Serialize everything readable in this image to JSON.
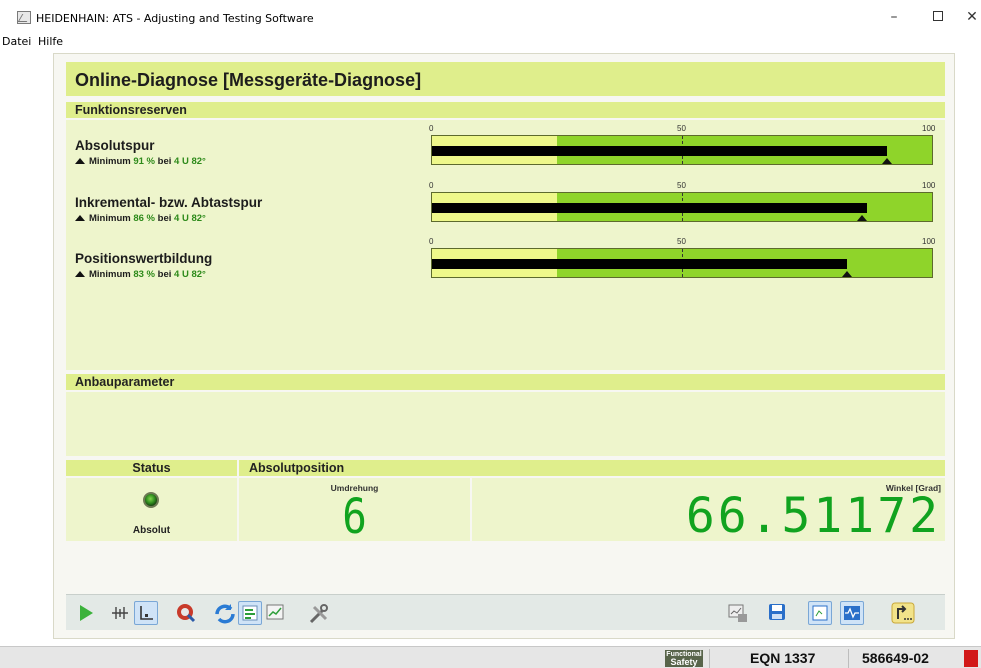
{
  "window": {
    "title": "HEIDENHAIN: ATS - Adjusting and Testing Software",
    "min_symbol": "–",
    "close_symbol": "✕"
  },
  "menu": [
    "Datei",
    "Hilfe"
  ],
  "header": {
    "title": "Online-Diagnose [Messgeräte-Diagnose]"
  },
  "sections": {
    "funktionsreserven": "Funktionsreserven",
    "anbauparameter": "Anbauparameter"
  },
  "scale_labels": [
    "0",
    "50",
    "100"
  ],
  "reserves": [
    {
      "name": "Absolutspur",
      "min_prefix": "Minimum",
      "min_value": "91 %",
      "bei": "bei",
      "at_value": "4 U 82°",
      "value": 91,
      "minimum": 91
    },
    {
      "name": "Inkremental- bzw. Abtastspur",
      "min_prefix": "Minimum",
      "min_value": "86 %",
      "bei": "bei",
      "at_value": "4 U 82°",
      "value": 87,
      "minimum": 86
    },
    {
      "name": "Positionswertbildung",
      "min_prefix": "Minimum",
      "min_value": "83 %",
      "bei": "bei",
      "at_value": "4 U 82°",
      "value": 83,
      "minimum": 83
    }
  ],
  "status": {
    "header": "Status",
    "text": "Absolut",
    "led_color": "#2f8a1e"
  },
  "position": {
    "header": "Absolutposition",
    "rev_label": "Umdrehung",
    "rev_value": "6",
    "angle_label": "Winkel [Grad]",
    "angle_value": "66.51172"
  },
  "toolbar": {
    "icons": [
      "play-icon",
      "grid-icon",
      "axis-icon",
      "magnet-icon",
      "refresh-icon",
      "bars-icon",
      "chart-icon",
      "tools-icon",
      "export-icon",
      "save-icon",
      "view-icon",
      "scope-icon",
      "exit-icon"
    ]
  },
  "footer": {
    "badge_top": "Functional",
    "badge_bottom": "Safety",
    "device": "EQN 1337",
    "id": "586649-02"
  },
  "colors": {
    "accent": "#dfee8c",
    "panel_green": "#eef5cc",
    "bar_green": "#8fd42a",
    "bar_yellow": "#eef88a",
    "digit_green": "#11a31f"
  }
}
